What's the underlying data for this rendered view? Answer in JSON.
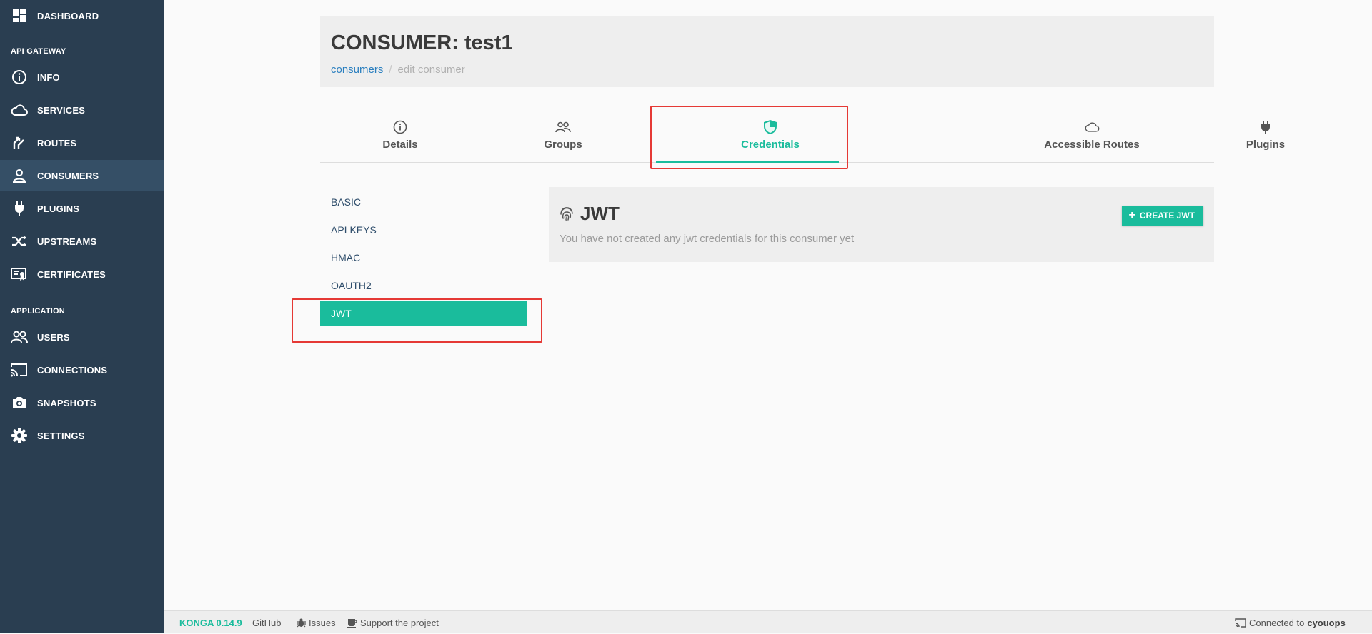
{
  "sidebar": {
    "dashboard": "DASHBOARD",
    "section_gateway": "API GATEWAY",
    "info": "INFO",
    "services": "SERVICES",
    "routes": "ROUTES",
    "consumers": "CONSUMERS",
    "plugins": "PLUGINS",
    "upstreams": "UPSTREAMS",
    "certificates": "CERTIFICATES",
    "section_application": "APPLICATION",
    "users": "USERS",
    "connections": "CONNECTIONS",
    "snapshots": "SNAPSHOTS",
    "settings": "SETTINGS"
  },
  "header": {
    "title": "CONSUMER: test1",
    "breadcrumb_link": "consumers",
    "breadcrumb_separator": "/",
    "breadcrumb_current": "edit consumer"
  },
  "tabs": {
    "details": "Details",
    "groups": "Groups",
    "credentials": "Credentials",
    "accessible_routes": "Accessible Routes",
    "plugins": "Plugins"
  },
  "credentials_nav": {
    "basic": "BASIC",
    "api_keys": "API KEYS",
    "hmac": "HMAC",
    "oauth2": "OAUTH2",
    "jwt": "JWT"
  },
  "jwt_panel": {
    "title": "JWT",
    "empty_message": "You have not created any jwt credentials for this consumer yet",
    "create_button": "CREATE JWT"
  },
  "footer": {
    "version": "KONGA 0.14.9",
    "github": "GitHub",
    "issues": "Issues",
    "support": "Support the project",
    "connected_prefix": "Connected to",
    "connection_name": "cyouops"
  },
  "colors": {
    "sidebar_bg": "#2a3e51",
    "sidebar_active": "#354f66",
    "accent": "#1abc9c",
    "highlight": "#e53935",
    "link": "#2a7fbf"
  }
}
